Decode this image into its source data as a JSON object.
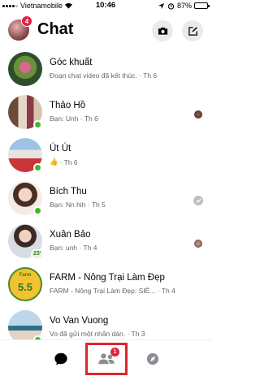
{
  "status_bar": {
    "carrier": "Vietnamobile",
    "time": "10:46",
    "battery": "87%",
    "battery_level": 0.87
  },
  "header": {
    "title": "Chat",
    "profile_badge_count": "4"
  },
  "chats": [
    {
      "name": "Góc khuất",
      "preview": "Đoạn chat video đã kết thúc. · Th 6",
      "online": false,
      "receipt": "none"
    },
    {
      "name": "Thảo Hồ",
      "preview": "Bạn: Unh · Th 6",
      "online": true,
      "receipt": "avatar"
    },
    {
      "name": "Út Út",
      "preview_emoji": "👍",
      "preview": " · Th 6",
      "online": true,
      "receipt": "none"
    },
    {
      "name": "Bích Thu",
      "preview": "Bạn: Nn hih · Th 5",
      "online": true,
      "receipt": "sent-check"
    },
    {
      "name": "Xuân Bảo",
      "preview": "Bạn: unh · Th 4",
      "online": false,
      "avatar_badge": "23'",
      "receipt": "avatar"
    },
    {
      "name": "FARM - Nông Trại Làm Đẹp",
      "preview": "FARM - Nông Trại Làm Đẹp: SIÊ... · Th 4",
      "online": false,
      "avatar_text": "5.5",
      "avatar_label": "Farm",
      "receipt": "none"
    },
    {
      "name": "Vo Van Vuong",
      "preview": "Vo đã gửi một nhãn dán. · Th 3",
      "online": true,
      "receipt": "none"
    }
  ],
  "bottom_nav": {
    "people_badge": "1"
  },
  "colors": {
    "online": "#42b72a",
    "badge": "#e41e3f",
    "highlight_box": "#e0242e",
    "secondary_text": "#65676b"
  }
}
